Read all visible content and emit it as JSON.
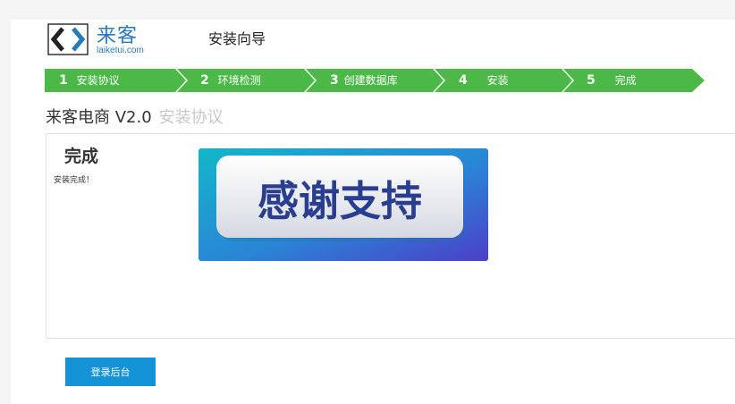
{
  "header": {
    "logo_cn": "来客",
    "logo_en": "laiketui.com",
    "wizard_title": "安装向导"
  },
  "steps": [
    {
      "num": "1",
      "label": "安装协议"
    },
    {
      "num": "2",
      "label": "环境检测"
    },
    {
      "num": "3",
      "label": "创建数据库"
    },
    {
      "num": "4",
      "label": "安装"
    },
    {
      "num": "5",
      "label": "完成"
    }
  ],
  "product": {
    "name": "来客电商 V2.0",
    "subtitle": "安装协议"
  },
  "panel": {
    "title": "完成",
    "message": "安装完成！",
    "banner_text": "感谢支持"
  },
  "actions": {
    "login_label": "登录后台"
  },
  "colors": {
    "steps_green": "#4cb848",
    "button_blue": "#1593d7",
    "logo_blue": "#2a7ab8"
  }
}
